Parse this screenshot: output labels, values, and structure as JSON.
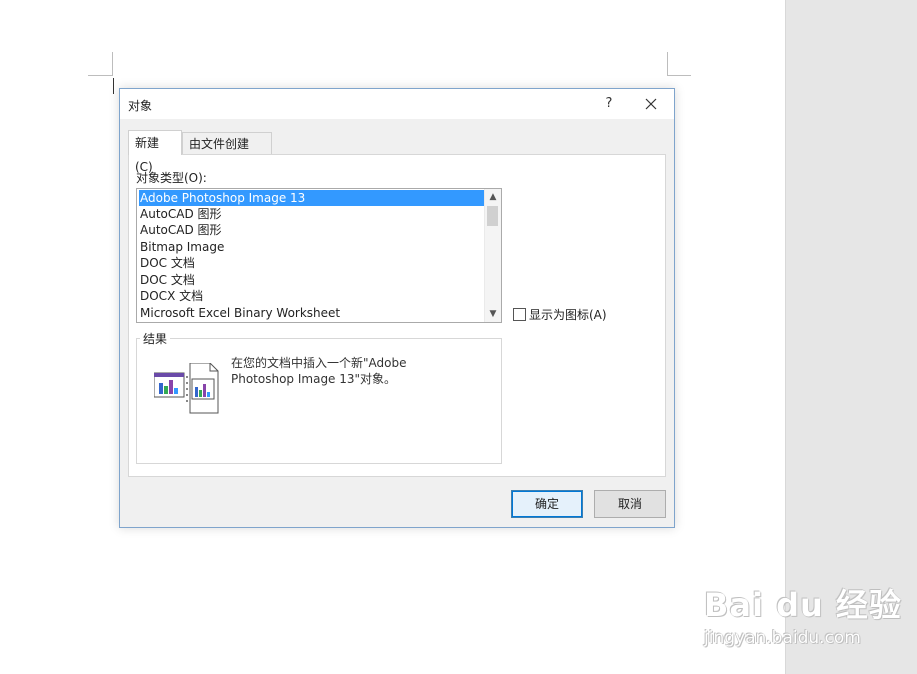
{
  "dialog": {
    "title": "对象",
    "help_label": "?",
    "tabs": [
      {
        "label": "新建(C)",
        "active": true
      },
      {
        "label": "由文件创建(F)",
        "active": false
      }
    ],
    "object_type_label": "对象类型(O):",
    "object_types": [
      "Adobe Photoshop Image 13",
      "AutoCAD 图形",
      "AutoCAD 图形",
      "Bitmap Image",
      "DOC 文档",
      "DOC 文档",
      "DOCX 文档",
      "Microsoft Excel Binary Worksheet"
    ],
    "selected_index": 0,
    "display_as_icon_label": "显示为图标(A)",
    "display_as_icon_checked": false,
    "result_label": "结果",
    "result_text": "在您的文档中插入一个新\"Adobe Photoshop Image 13\"对象。",
    "ok_label": "确定",
    "cancel_label": "取消"
  },
  "watermark": {
    "main": "Bai du 经验",
    "sub": "jingyan.baidu.com"
  },
  "icons": {
    "close": "close-icon",
    "scroll_up": "chevron-up-icon",
    "scroll_down": "chevron-down-icon",
    "result": "embedded-object-icon"
  },
  "colors": {
    "selection": "#3399ff",
    "ok_border": "#0078d7",
    "side_panel": "#e6e6e6"
  }
}
